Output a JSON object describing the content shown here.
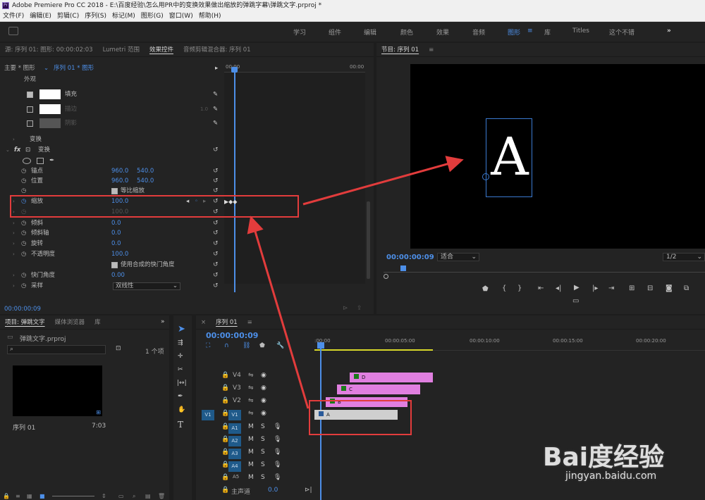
{
  "window": {
    "title": "Adobe Premiere Pro CC 2018 - E:\\百度经验\\怎么用PR中的变换效果做出缩放的弹跳字幕\\弹跳文字.prproj *",
    "logo": "Pr"
  },
  "menu": [
    "文件(F)",
    "编辑(E)",
    "剪辑(C)",
    "序列(S)",
    "标记(M)",
    "图形(G)",
    "窗口(W)",
    "帮助(H)"
  ],
  "workspaces": [
    "学习",
    "组件",
    "编辑",
    "颜色",
    "效果",
    "音频",
    "图形",
    "库",
    "Titles",
    "这个不错"
  ],
  "workspace_active": "图形",
  "effect_panel": {
    "tabs": [
      "源: 序列 01: 图形: 00:00:02:03",
      "Lumetri 范围",
      "效果控件",
      "音频剪辑混合器: 序列 01"
    ],
    "active_tab": "效果控件",
    "clip_path": "主要 * 图形",
    "sequence_path": "序列 01 * 图形",
    "ruler_start": "00:00",
    "ruler_end": "00:00",
    "appearance_label": "外观",
    "fill_label": "填充",
    "stroke_label": "描边",
    "stroke_value": "1.0",
    "shadow_label": "阴影",
    "transform_group": "变换",
    "fx_label": "fx",
    "transform_label": "变换",
    "anchor_label": "锚点",
    "anchor_x": "960.0",
    "anchor_y": "540.0",
    "position_label": "位置",
    "position_x": "960.0",
    "position_y": "540.0",
    "uniform_scale_label": "等比缩放",
    "scale_label": "缩放",
    "scale_value": "100.0",
    "scale_width_value": "100.0",
    "skew_label": "倾斜",
    "skew_value": "0.0",
    "skew_axis_label": "倾斜轴",
    "skew_axis_value": "0.0",
    "rotation_label": "旋转",
    "rotation_value": "0.0",
    "opacity_label": "不透明度",
    "opacity_value": "100.0",
    "composite_shutter_label": "使用合成的快门角度",
    "shutter_angle_label": "快门角度",
    "shutter_angle_value": "0.00",
    "sampling_label": "采样",
    "sampling_value": "双线性",
    "timecode": "00:00:00:09"
  },
  "program_monitor": {
    "title": "节目: 序列 01",
    "letter": "A",
    "timecode": "00:00:00:09",
    "fit": "适合",
    "resolution": "1/2"
  },
  "project_panel": {
    "tabs": [
      "项目: 弹跳文字",
      "媒体浏览器",
      "库"
    ],
    "active_tab": "项目: 弹跳文字",
    "file": "弹跳文字.prproj",
    "item_count": "1 个项",
    "item_name": "序列 01",
    "item_duration": "7:03"
  },
  "timeline": {
    "tab": "序列 01",
    "timecode": "00:00:00:09",
    "ruler": [
      ":00:00",
      "00:00:05:00",
      "00:00:10:00",
      "00:00:15:00",
      "00:00:20:00"
    ],
    "video_tracks": [
      "V4",
      "V3",
      "V2",
      "V1"
    ],
    "audio_tracks": [
      "A1",
      "A2",
      "A3",
      "A4",
      "A5"
    ],
    "source_patch": "V1",
    "master_label": "主声道",
    "master_value": "0.0",
    "mute": "M",
    "solo": "S",
    "clips": [
      {
        "track": "V4",
        "label": "D",
        "color": "#e07fe0"
      },
      {
        "track": "V3",
        "label": "C",
        "color": "#e07fe0"
      },
      {
        "track": "V2",
        "label": "B",
        "color": "#e07fe0"
      },
      {
        "track": "V1",
        "label": "A",
        "color": "#cfcfcf"
      }
    ]
  },
  "watermark": {
    "brand": "Bai度经验",
    "url": "jingyan.baidu.com"
  },
  "colors": {
    "accent": "#4d8fe8",
    "annotation_red": "#e23c3c",
    "clip_pink": "#e07fe0",
    "playhead": "#4d8fe8"
  }
}
